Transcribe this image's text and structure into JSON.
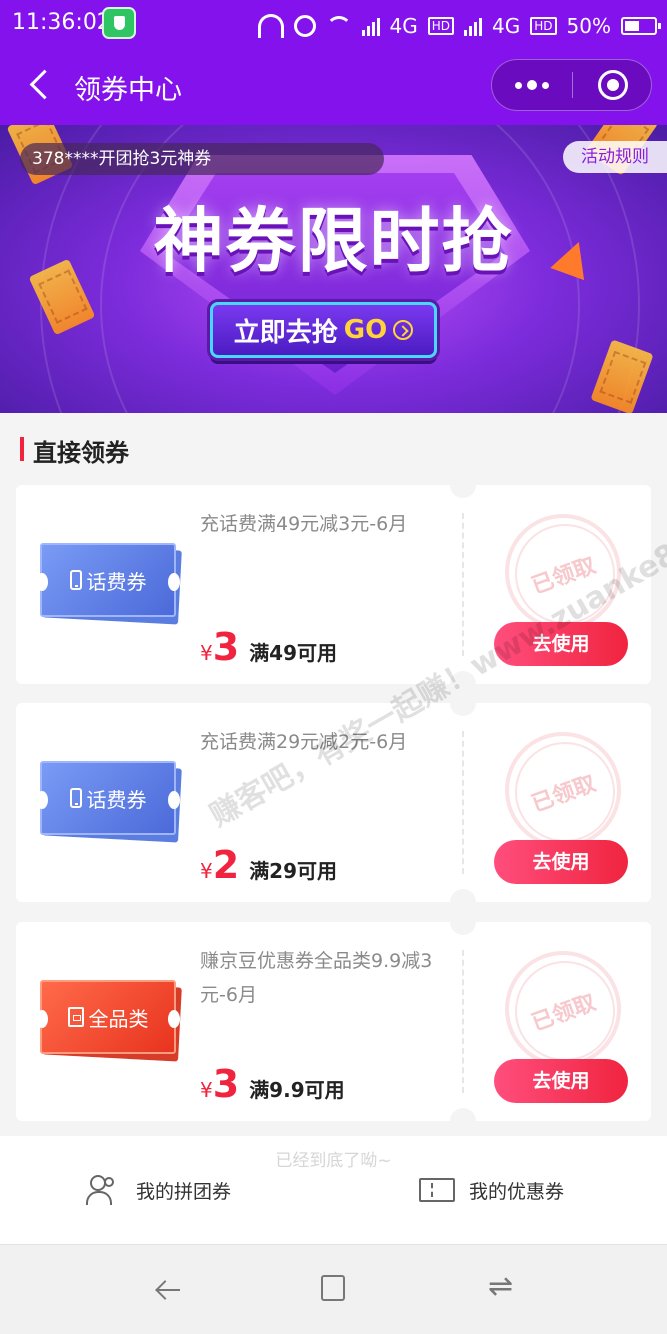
{
  "status_bar": {
    "time": "11:36:02",
    "network": "4G",
    "hd": "HD",
    "battery": "50%"
  },
  "nav": {
    "title": "领券中心"
  },
  "banner": {
    "marquee": "378****开团抢3元神券",
    "rules": "活动规则",
    "headline": "神券限时抢",
    "cta_text": "立即去抢",
    "cta_go": "GO"
  },
  "section": {
    "title": "直接领券"
  },
  "coupons": [
    {
      "tag": "话费券",
      "desc": "充话费满49元减3元-6月",
      "yen": "¥",
      "amount": "3",
      "condition": "满49可用",
      "stamp": "已领取",
      "button": "去使用"
    },
    {
      "tag": "话费券",
      "desc": "充话费满29元减2元-6月",
      "yen": "¥",
      "amount": "2",
      "condition": "满29可用",
      "stamp": "已领取",
      "button": "去使用"
    },
    {
      "tag": "全品类",
      "desc": "赚京豆优惠券全品类9.9减3元-6月",
      "yen": "¥",
      "amount": "3",
      "condition": "满9.9可用",
      "stamp": "已领取",
      "button": "去使用"
    }
  ],
  "end_tip": "已经到底了呦~",
  "bottom_bar": {
    "group_coupons": "我的拼团券",
    "my_coupons": "我的优惠券"
  },
  "watermark": "赚客吧，有奖一起赚！www.zuanke8.com"
}
